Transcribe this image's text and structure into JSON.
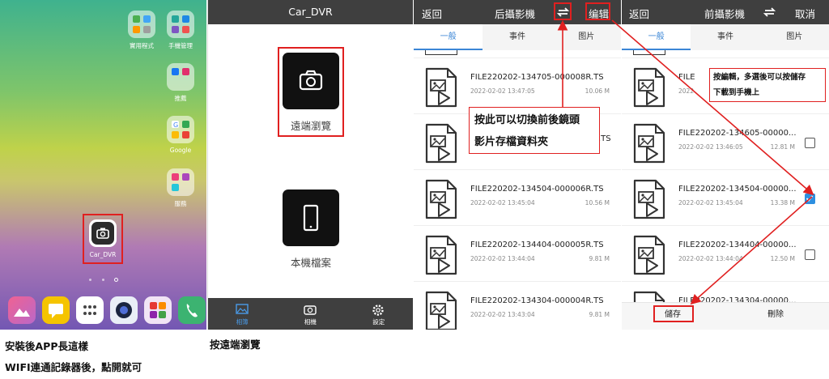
{
  "panel1": {
    "apps": [
      {
        "label": "實用程式",
        "icon": "folder-icon"
      },
      {
        "label": "手機管理",
        "icon": "folder-icon"
      },
      {
        "label": "推薦",
        "icon": "folder-icon"
      },
      {
        "label": "Google",
        "icon": "folder-icon"
      },
      {
        "label": "服務",
        "icon": "folder-icon"
      }
    ],
    "dvr_label": "Car_DVR",
    "dock": [
      "gallery-icon",
      "messages-icon",
      "apps-drawer-icon",
      "camera-icon",
      "games-icon",
      "phone-icon"
    ],
    "caption_line1": "安裝後APP長這樣",
    "caption_line2": "WIFI連通記錄器後，點開就可"
  },
  "panel2": {
    "title": "Car_DVR",
    "remote_label": "遠端瀏覽",
    "local_label": "本機檔案",
    "nav": [
      {
        "label": "相簿",
        "icon": "album-icon",
        "active": true
      },
      {
        "label": "相機",
        "icon": "camera-icon",
        "active": false
      },
      {
        "label": "設定",
        "icon": "gear-icon",
        "active": false
      }
    ],
    "caption": "按遠端瀏覽"
  },
  "panel3": {
    "back": "返回",
    "title": "后攝影機",
    "edit": "编辑",
    "tabs": [
      "一般",
      "事件",
      "图片"
    ],
    "files": [
      {
        "name": "FILE220202-134705-000008R.TS",
        "date": "2022-02-02 13:47:05",
        "size": "10.06 M"
      },
      {
        "name": "",
        "date": "",
        "size": ""
      },
      {
        "name": "FILE220202-134504-000006R.TS",
        "date": "2022-02-02 13:45:04",
        "size": "10.56 M"
      },
      {
        "name": "FILE220202-134404-000005R.TS",
        "date": "2022-02-02 13:44:04",
        "size": "9.81 M"
      },
      {
        "name": "FILE220202-134304-000004R.TS",
        "date": "2022-02-02 13:43:04",
        "size": "9.81 M"
      }
    ],
    "partial_file": ".TS",
    "callout_line1": "按此可以切換前後鏡頭",
    "callout_line2": "影片存檔資料夾"
  },
  "panel4": {
    "back": "返回",
    "title": "前攝影機",
    "cancel": "取消",
    "tabs": [
      "一般",
      "事件",
      "图片"
    ],
    "files": [
      {
        "name": "FILE",
        "date": "2022",
        "size": "",
        "checked": null
      },
      {
        "name": "FILE220202-134605-00000...",
        "date": "2022-02-02 13:46:05",
        "size": "12.81 M",
        "checked": false
      },
      {
        "name": "FILE220202-134504-00000...",
        "date": "2022-02-02 13:45:04",
        "size": "13.38 M",
        "checked": true
      },
      {
        "name": "FILE220202-134404-00000...",
        "date": "2022-02-02 13:44:04",
        "size": "12.50 M",
        "checked": false
      },
      {
        "name": "FILE220202-134304-00000...",
        "date": "",
        "size": "",
        "checked": null
      }
    ],
    "callout_line1": "按編輯，多選後可以按儲存",
    "callout_line2": "下載到手機上",
    "save": "儲存",
    "delete": "刪除"
  },
  "colors": {
    "accent": "#3b86d6",
    "annotation": "#e02020",
    "topbar": "#3f3f3f"
  }
}
